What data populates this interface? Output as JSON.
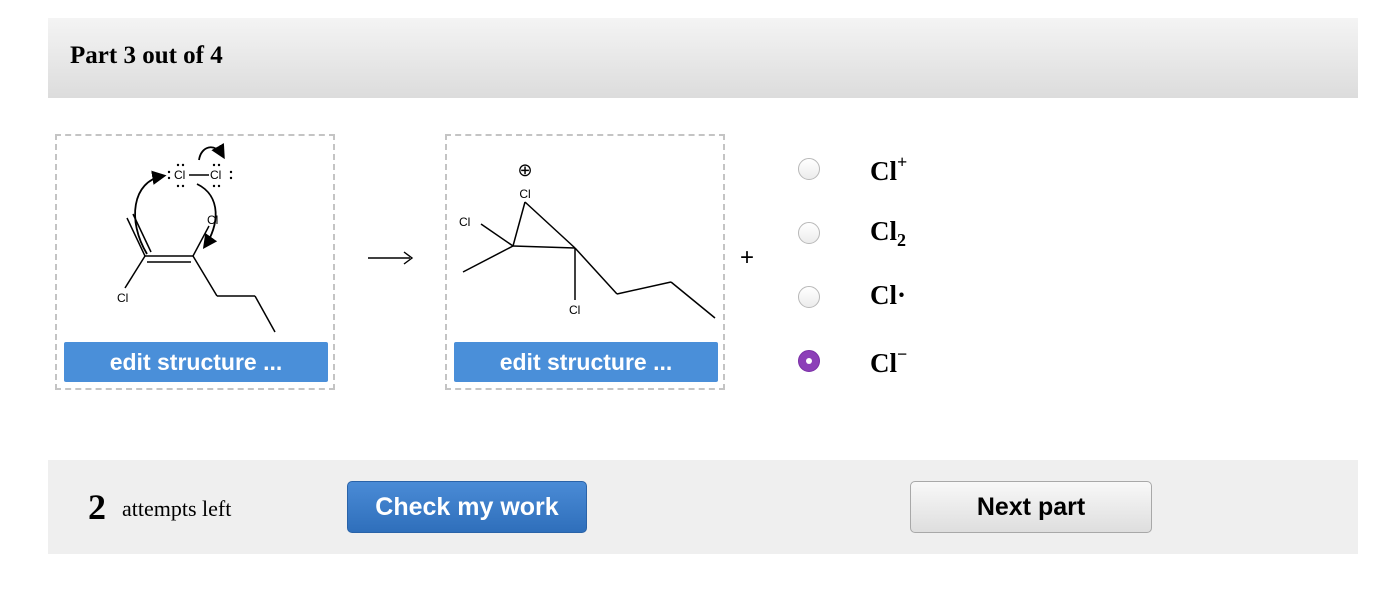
{
  "header": {
    "title": "Part 3 out of 4"
  },
  "reactant": {
    "edit_label": "edit structure ...",
    "atom_labels": [
      "Cl",
      "Cl",
      "Cl",
      "Cl"
    ],
    "lone_pair_glyph": ":"
  },
  "product": {
    "edit_label": "edit structure ...",
    "atom_labels": [
      "Cl",
      "Cl",
      "Cl"
    ],
    "charge_symbol": "⊕"
  },
  "reaction_arrow": "⟶",
  "plus_sign": "+",
  "options": [
    {
      "base": "Cl",
      "sup": "+",
      "sub": "",
      "selected": false
    },
    {
      "base": "Cl",
      "sup": "",
      "sub": "2",
      "selected": false
    },
    {
      "base": "Cl·",
      "sup": "",
      "sub": "",
      "selected": false
    },
    {
      "base": "Cl",
      "sup": "−",
      "sub": "",
      "selected": true
    }
  ],
  "footer": {
    "attempts_count": "2",
    "attempts_text": "attempts left",
    "check_label": "Check my work",
    "next_label": "Next part"
  },
  "colors": {
    "edit_button": "#4a8fd9",
    "check_button": "#2f6fbb",
    "radio_selected": "#8c3fb8",
    "header_bg": "#e6e6e6",
    "footer_bg": "#efefef"
  }
}
